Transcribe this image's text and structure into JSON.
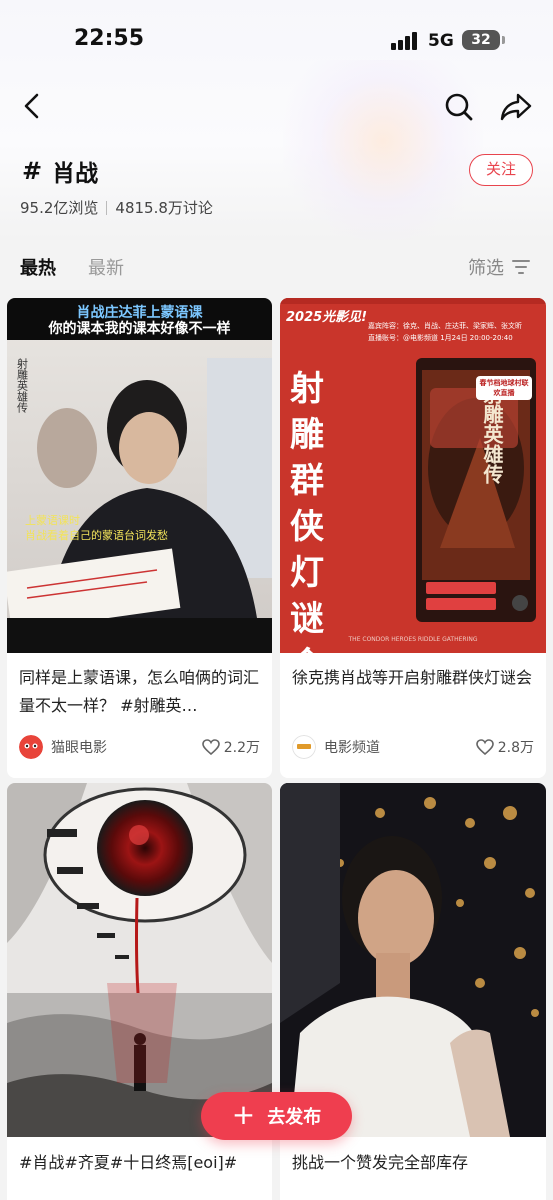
{
  "status_bar": {
    "time": "22:55",
    "network": "5G",
    "battery": "32"
  },
  "topic": {
    "hash": "#",
    "name": "肖战",
    "views": "95.2亿浏览",
    "discussions": "4815.8万讨论",
    "follow_label": "关注"
  },
  "tabs": [
    {
      "label": "最热",
      "active": true
    },
    {
      "label": "最新",
      "active": false
    }
  ],
  "filter_label": "筛选",
  "cards": [
    {
      "title": "同样是上蒙语课，怎么咱俩的词汇量不太一样？ #射雕英…",
      "author": "猫眼电影",
      "likes": "2.2万",
      "cover": {
        "headline1": "肖战庄达菲上蒙语课",
        "headline2": "你的课本我的课本好像不一样",
        "subtitle1": "上蒙语课时",
        "subtitle2": "肖战看着自己的蒙语台词发愁"
      }
    },
    {
      "title": "徐克携肖战等开启射雕群侠灯谜会",
      "author": "电影频道",
      "likes": "2.8万",
      "cover": {
        "tag": "2025光影见!",
        "vertical_title": "射雕群侠灯谜会",
        "guests": "嘉宾阵容：徐克、肖战、庄达菲、梁家辉、张文昕",
        "live": "直播账号：@电影频道  1月24日 20:00-20:40",
        "poster_title": "射雕英雄传",
        "spring": "春节档地球村联欢直播",
        "bottom": "THE CONDOR HEROES RIDDLE GATHERING"
      }
    },
    {
      "title": "#肖战#齐夏#十日终焉[eoi]#",
      "author": "",
      "likes": ""
    },
    {
      "title": "挑战一个赞发完全部库存",
      "author": "",
      "likes": ""
    }
  ],
  "publish_label": "去发布"
}
